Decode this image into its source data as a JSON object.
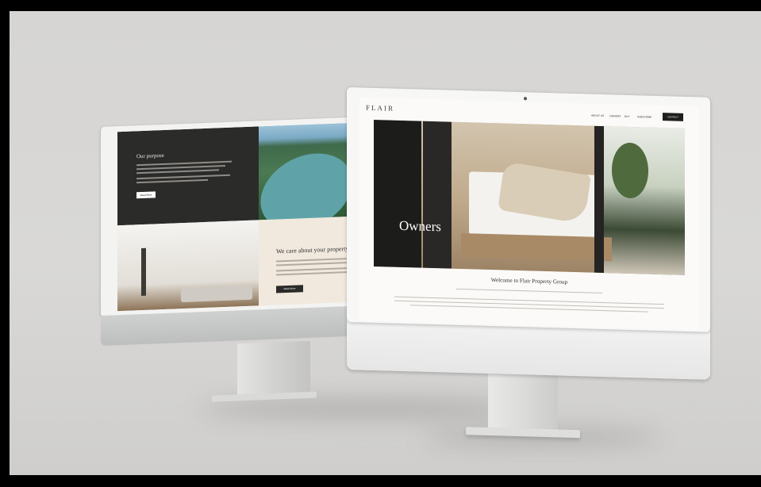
{
  "back_monitor": {
    "panel_heading": "Our purpose",
    "panel_button": "Read More",
    "cream_heading": "We care about your property",
    "cream_button": "Read More"
  },
  "front_monitor": {
    "logo": "FLAIR",
    "nav_items": [
      "ABOUT US",
      "OWNERS",
      "BUY",
      "SUBSCRIBE"
    ],
    "contact_button": "CONTACT",
    "hero_title": "Owners",
    "welcome_heading": "Welcome to Flair Property Group"
  }
}
